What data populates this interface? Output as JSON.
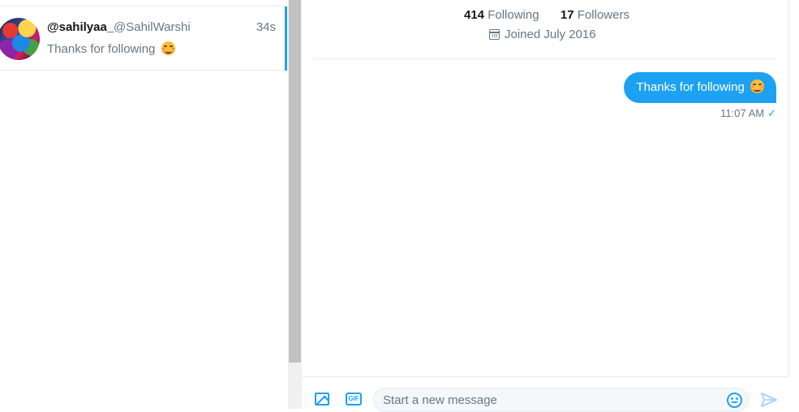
{
  "conversation_list": {
    "items": [
      {
        "display_name": "@sahilyaa_",
        "handle": "@SahilWarshi",
        "time": "34s",
        "preview": "Thanks for following",
        "preview_emoji": "smiling-face-emoji",
        "active": true
      }
    ]
  },
  "profile_header": {
    "following_count": "414",
    "following_label": "Following",
    "followers_count": "17",
    "followers_label": "Followers",
    "joined_text": "Joined July 2016"
  },
  "messages": [
    {
      "text": "Thanks for following",
      "emoji": "smiling-face-emoji",
      "time": "11:07 AM",
      "status_icon": "check-icon",
      "outgoing": true
    }
  ],
  "composer": {
    "placeholder": "Start a new message",
    "value": "",
    "gif_label": "GIF"
  },
  "colors": {
    "accent": "#1da1f2",
    "text_primary": "#14171a",
    "text_secondary": "#657786",
    "border": "#e6ecf0"
  }
}
